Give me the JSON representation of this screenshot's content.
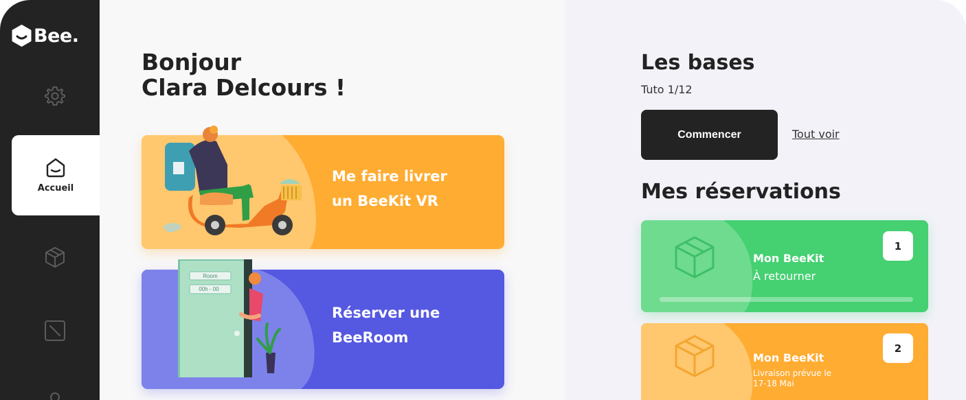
{
  "app": {
    "logo_text": "Bee."
  },
  "sidebar": {
    "active_item": {
      "label": "Accueil",
      "icon": "home-icon"
    },
    "icons": [
      "gear-icon",
      "home-icon",
      "cube-icon",
      "slash-square-icon",
      "user-icon"
    ]
  },
  "main": {
    "greeting_line1": "Bonjour",
    "greeting_line2": "Clara Delcours !",
    "cards": [
      {
        "line1": "Me faire livrer",
        "line2": "un BeeKit VR",
        "color": "#ffac33",
        "illustration": "scooter-delivery"
      },
      {
        "line1": "Réserver une",
        "line2": "BeeRoom",
        "color": "#5558e0",
        "illustration": "door-room",
        "door_sign_1": "Room",
        "door_sign_2": "00h - 00"
      }
    ]
  },
  "right": {
    "bases_title": "Les bases",
    "tuto_text": "Tuto 1/12",
    "start_button": "Commencer",
    "see_all_link": "Tout voir",
    "reservations_title": "Mes réservations",
    "reservations": [
      {
        "title": "Mon BeeKit",
        "subtitle": "À retourner",
        "number": "1",
        "color": "#45d072"
      },
      {
        "title": "Mon BeeKit",
        "subtitle_line1": "Livraison prévue le",
        "subtitle_line2": "17-18 Mai",
        "number": "2",
        "color": "#ffac33"
      }
    ]
  }
}
